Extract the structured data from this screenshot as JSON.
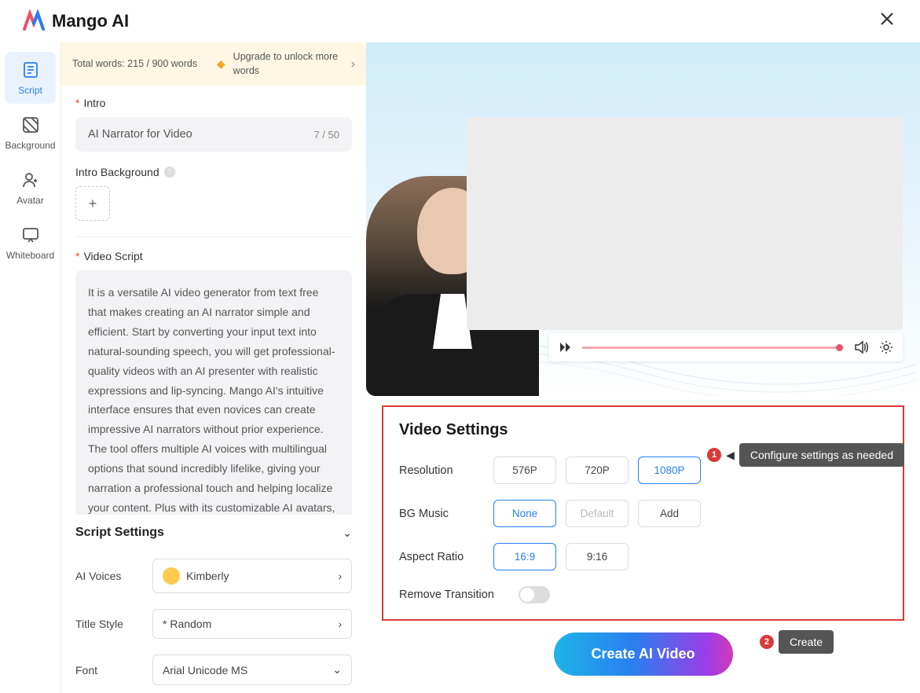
{
  "app": {
    "name": "Mango AI"
  },
  "sidebar": {
    "items": [
      {
        "label": "Script"
      },
      {
        "label": "Background"
      },
      {
        "label": "Avatar"
      },
      {
        "label": "Whiteboard"
      }
    ]
  },
  "upgrade": {
    "words": "Total words: 215 / 900 words",
    "msg": "Upgrade to unlock more words"
  },
  "intro": {
    "label": "Intro",
    "value": "AI Narrator for Video",
    "counter": "7 / 50",
    "bg_label": "Intro Background"
  },
  "script": {
    "label": "Video Script",
    "text": "It is a versatile AI video generator from text free that makes creating an AI narrator simple and efficient. Start by converting your input text into natural-sounding speech, you will get professional-quality videos with an AI presenter with realistic expressions and lip-syncing. Mango AI's intuitive interface ensures that even novices can create impressive AI narrators without prior experience. The tool offers multiple AI voices with multilingual options that sound incredibly lifelike, giving your narration a professional touch and helping localize your content. Plus with its customizable AI avatars, you can easily create video content to enhance visual appeal and interactivity."
  },
  "settings": {
    "title": "Script Settings",
    "voice_label": "AI Voices",
    "voice_value": "Kimberly",
    "title_label": "Title Style",
    "title_value": "* Random",
    "font_label": "Font",
    "font_value": "Arial Unicode MS"
  },
  "video_settings": {
    "title": "Video Settings",
    "resolution": {
      "label": "Resolution",
      "opts": [
        "576P",
        "720P",
        "1080P"
      ],
      "selected": "1080P"
    },
    "bgmusic": {
      "label": "BG Music",
      "opts": [
        "None",
        "Default",
        "Add"
      ],
      "selected": "None",
      "disabled": "Default"
    },
    "aspect": {
      "label": "Aspect Ratio",
      "opts": [
        "16:9",
        "9:16"
      ],
      "selected": "16:9"
    },
    "remove": {
      "label": "Remove Transition"
    }
  },
  "callouts": {
    "c1": "Configure settings as needed",
    "c2": "Create"
  },
  "create_btn": "Create AI Video"
}
